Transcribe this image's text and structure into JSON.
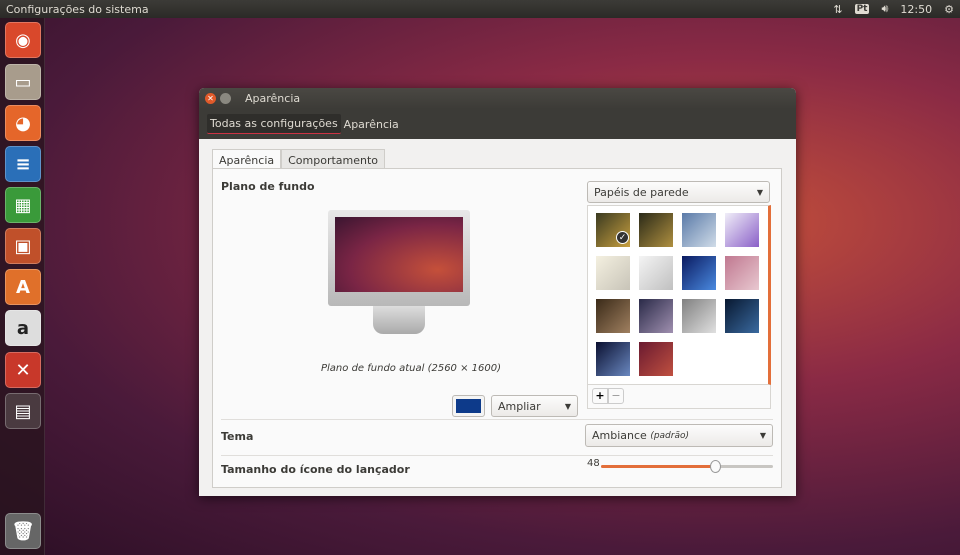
{
  "topbar": {
    "title": "Configurações do sistema",
    "keyboard": "Pt",
    "time": "12:50"
  },
  "launcher": [
    {
      "name": "dash",
      "glyph": "◉",
      "color": "#d9482b"
    },
    {
      "name": "files",
      "glyph": "▭",
      "color": "#a89c8c"
    },
    {
      "name": "firefox",
      "glyph": "◕",
      "color": "#e5662a"
    },
    {
      "name": "writer",
      "glyph": "≡",
      "color": "#2a6fb8"
    },
    {
      "name": "calc",
      "glyph": "▦",
      "color": "#3a9a3a"
    },
    {
      "name": "impress",
      "glyph": "▣",
      "color": "#c0502a"
    },
    {
      "name": "software-center",
      "glyph": "A",
      "color": "#e0702a"
    },
    {
      "name": "amazon",
      "glyph": "a",
      "color": "#dddddd"
    },
    {
      "name": "system-settings",
      "glyph": "✕",
      "color": "#c8382a"
    },
    {
      "name": "workspace-switcher",
      "glyph": "▤",
      "color": "#4a3a40"
    },
    {
      "name": "trash",
      "glyph": "🗑",
      "color": "#666"
    }
  ],
  "window": {
    "title": "Aparência",
    "breadcrumbs": [
      "Todas as configurações",
      "Aparência"
    ],
    "tabs": [
      "Aparência",
      "Comportamento"
    ],
    "background": {
      "label": "Plano de fundo",
      "source": "Papéis de parede",
      "caption": "Plano de fundo atual (2560 × 1600)",
      "color": "#0d3a8a",
      "mode": "Ampliar",
      "wallpapers": [
        {
          "c1": "#3a3a20",
          "c2": "#c8a040",
          "selected": true
        },
        {
          "c1": "#2a2a18",
          "c2": "#b09040",
          "selected": false
        },
        {
          "c1": "#5a7aa8",
          "c2": "#d0dce8",
          "selected": false
        },
        {
          "c1": "#f0eef8",
          "c2": "#8a60c8",
          "selected": false
        },
        {
          "c1": "#f4f0e0",
          "c2": "#c8c4b8",
          "selected": false
        },
        {
          "c1": "#f4f4f4",
          "c2": "#c0c0c0",
          "selected": false
        },
        {
          "c1": "#0a1a60",
          "c2": "#4a8ae0",
          "selected": false
        },
        {
          "c1": "#c07890",
          "c2": "#e8c8d0",
          "selected": false
        },
        {
          "c1": "#3a2a18",
          "c2": "#a08060",
          "selected": false
        },
        {
          "c1": "#2a2a48",
          "c2": "#a090b0",
          "selected": false
        },
        {
          "c1": "#808080",
          "c2": "#e0e0e0",
          "selected": false
        },
        {
          "c1": "#081830",
          "c2": "#3a6aa0",
          "selected": false
        },
        {
          "c1": "#0a1030",
          "c2": "#6a88c0",
          "selected": false
        },
        {
          "c1": "#6a1a30",
          "c2": "#c05040",
          "selected": false
        }
      ],
      "add": "+",
      "remove": "−"
    },
    "theme": {
      "label": "Tema",
      "value": "Ambiance",
      "note": "(padrão)"
    },
    "icon_size": {
      "label": "Tamanho do ícone do lançador",
      "value": "48",
      "min": 16,
      "max": 64,
      "accent": "#e36f3a"
    }
  }
}
